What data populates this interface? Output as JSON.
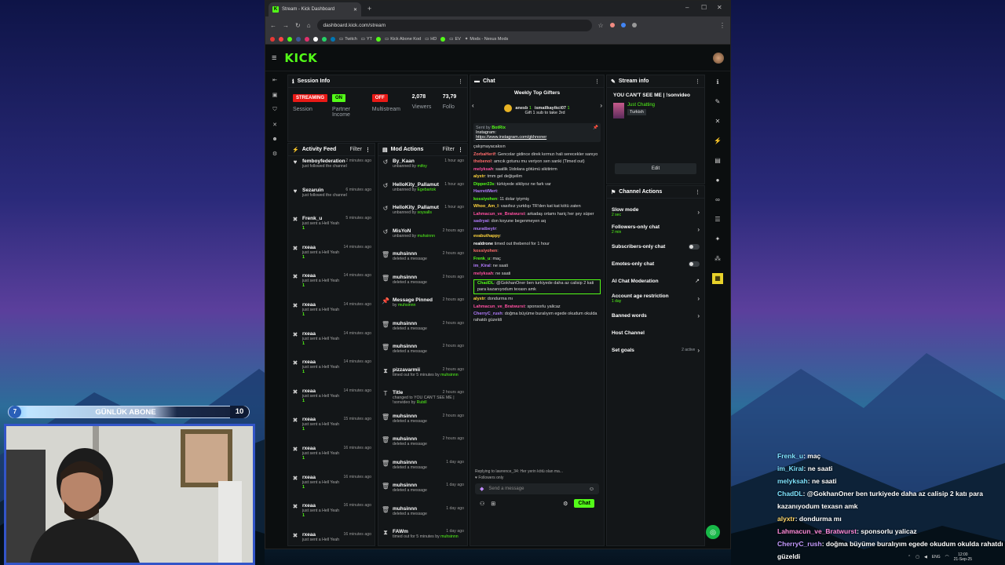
{
  "browser": {
    "tab_title": "Stream - Kick Dashboard",
    "url": "dashboard.kick.com/stream",
    "bookmarks": [
      "Twitch",
      "YT",
      "Kick Abone Kod",
      "HD",
      "EV",
      "Mods - Nexus Mods"
    ]
  },
  "kick": {
    "logo": "KICK"
  },
  "session": {
    "title": "Session Info",
    "stats": [
      {
        "badge": "STREAMING",
        "label": "Session",
        "color": "#e91916"
      },
      {
        "badge": "ON",
        "label": "Partner Income",
        "color": "#53fc18"
      },
      {
        "badge": "OFF",
        "label": "Multistream",
        "color": "#e91916"
      },
      {
        "value": "2,078",
        "label": "Viewers"
      },
      {
        "value": "73,79",
        "label": "Follo"
      }
    ]
  },
  "activity": {
    "title": "Activity Feed",
    "filter": "Filter",
    "items": [
      {
        "icon": "heart-icon",
        "user": "femboyfederation",
        "action": "just followed the channel",
        "time": "2 minutes ago"
      },
      {
        "icon": "heart-icon",
        "user": "Sezaruin",
        "action": "just followed the channel",
        "time": "6 minutes ago"
      },
      {
        "icon": "kick-icon",
        "user": "Frenk_u",
        "action": "just sent a Hell Yeah",
        "count": "1",
        "time": "5 minutes ago"
      },
      {
        "icon": "kick-icon",
        "user": "rxeaa",
        "action": "just sent a Hell Yeah",
        "count": "1",
        "time": "14 minutes ago"
      },
      {
        "icon": "kick-icon",
        "user": "rxeaa",
        "action": "just sent a Hell Yeah",
        "count": "1",
        "time": "14 minutes ago"
      },
      {
        "icon": "kick-icon",
        "user": "rxeaa",
        "action": "just sent a Hell Yeah",
        "count": "1",
        "time": "14 minutes ago"
      },
      {
        "icon": "kick-icon",
        "user": "rxeaa",
        "action": "just sent a Hell Yeah",
        "count": "1",
        "time": "14 minutes ago"
      },
      {
        "icon": "kick-icon",
        "user": "rxeaa",
        "action": "just sent a Hell Yeah",
        "count": "1",
        "time": "14 minutes ago"
      },
      {
        "icon": "kick-icon",
        "user": "rxeaa",
        "action": "just sent a Hell Yeah",
        "count": "1",
        "time": "14 minutes ago"
      },
      {
        "icon": "kick-icon",
        "user": "rxeaa",
        "action": "just sent a Hell Yeah",
        "count": "1",
        "time": "15 minutes ago"
      },
      {
        "icon": "kick-icon",
        "user": "rxeaa",
        "action": "just sent a Hell Yeah",
        "count": "1",
        "time": "16 minutes ago"
      },
      {
        "icon": "kick-icon",
        "user": "rxeaa",
        "action": "just sent a Hell Yeah",
        "count": "1",
        "time": "16 minutes ago"
      },
      {
        "icon": "kick-icon",
        "user": "rxeaa",
        "action": "just sent a Hell Yeah",
        "count": "1",
        "time": "16 minutes ago"
      },
      {
        "icon": "kick-icon",
        "user": "rxeaa",
        "action": "just sent a Hell Yeah",
        "time": "16 minutes ago"
      }
    ]
  },
  "mod": {
    "title": "Mod Actions",
    "filter": "Filter",
    "items": [
      {
        "icon": "undo-icon",
        "user": "By_Kaan",
        "line1": "unbanned by",
        "by": "mifoy",
        "time": "1 hour ago"
      },
      {
        "icon": "undo-icon",
        "user": "HelloKity_Pallamut",
        "line1": "unbanned by",
        "by": "Egebartok",
        "time": "1 hour ago"
      },
      {
        "icon": "undo-icon",
        "user": "HelloKity_Pallamut",
        "line1": "unbanned by",
        "by": "soysalls",
        "time": "1 hour ago"
      },
      {
        "icon": "undo-icon",
        "user": "MisYoN",
        "line1": "unbanned by",
        "by": "muhsinnn",
        "time": "2 hours ago"
      },
      {
        "icon": "trash-icon",
        "user": "muhsinnn",
        "line1": "deleted a message",
        "time": "2 hours ago"
      },
      {
        "icon": "trash-icon",
        "user": "muhsinnn",
        "line1": "deleted a message",
        "time": "2 hours ago"
      },
      {
        "icon": "pin-icon",
        "user": "Message Pinned",
        "line1": "by",
        "by": "muhsinnn",
        "time": "2 hours ago"
      },
      {
        "icon": "trash-icon",
        "user": "muhsinnn",
        "line1": "deleted a message",
        "time": "2 hours ago"
      },
      {
        "icon": "trash-icon",
        "user": "muhsinnn",
        "line1": "deleted a message",
        "time": "2 hours ago"
      },
      {
        "icon": "hourglass-icon",
        "user": "pizzavarmii",
        "line1": "timed out for 5 minutes by",
        "by": "muhsinnn",
        "time": "2 hours ago"
      },
      {
        "icon": "title-icon",
        "user": "Title",
        "line1": "changed to YOU CAN'T SEE ME | !sonvideo by",
        "by": "Rubill",
        "time": "2 hours ago"
      },
      {
        "icon": "trash-icon",
        "user": "muhsinnn",
        "line1": "deleted a message",
        "time": "2 hours ago"
      },
      {
        "icon": "trash-icon",
        "user": "muhsinnn",
        "line1": "deleted a message",
        "time": "2 hours ago"
      },
      {
        "icon": "trash-icon",
        "user": "muhsinnn",
        "line1": "deleted a message",
        "time": "1 day ago"
      },
      {
        "icon": "trash-icon",
        "user": "muhsinnn",
        "line1": "deleted a message",
        "time": "1 day ago"
      },
      {
        "icon": "trash-icon",
        "user": "muhsinnn",
        "line1": "deleted a message",
        "time": "1 day ago"
      },
      {
        "icon": "hourglass-icon",
        "user": "FAWm",
        "line1": "timed out for 5 minutes by",
        "by": "muhsinnn",
        "time": "1 day ago"
      }
    ]
  },
  "chat": {
    "title": "Chat",
    "gifters_title": "Weekly Top Gifters",
    "gifters": [
      {
        "name": "anesb",
        "count": "1"
      },
      {
        "name": "ismailkayikci07",
        "count": "1"
      }
    ],
    "gift_cta": "Gift 1 sub to take 3rd",
    "pinned": {
      "sent_by": "Sent by",
      "bot": "BotRix",
      "text": "Instagram:",
      "link": "https://www.instagram.com/gkhnoner"
    },
    "messages": [
      {
        "user": "",
        "text": "çalışmayacaksın",
        "color": "#ddd"
      },
      {
        "user": "ZorbaHerif",
        "text": ": Gencolar gidince direk kırmızı hali serecekler sanıyo",
        "color": "#ff6b6b"
      },
      {
        "user": "thebenol",
        "text": ": amcık gotunu mu veriyon sen sanki (Timed out)",
        "color": "#ff6b6b"
      },
      {
        "user": "melyksah",
        "text": ": saatlik 1tdolara götümü sikitirirm",
        "color": "#ff4fa0"
      },
      {
        "user": "alyxtr",
        "text": ": tmm gel değişelim",
        "color": "#ffd53d"
      },
      {
        "user": "Dipper23s",
        "text": ": türkiyede sikliyoz ne fark var",
        "color": "#53fc18"
      },
      {
        "user": "HazretiMert",
        "text": ":",
        "color": "#b47cff"
      },
      {
        "user": "kossiyohen",
        "text": ": 11 dolar iyiymiş",
        "color": "#53fc18"
      },
      {
        "user": "Whoo_Am_I",
        "text": ": vasıfsız yurtdışı TR'den kat kat kötü zaten",
        "color": "#ffd53d"
      },
      {
        "user": "Lahmacun_ve_Bratwurst",
        "text": ": arkadaş ortamı hariç her şey süper",
        "color": "#ff4fa0"
      },
      {
        "user": "sadryat",
        "text": ": don koyune begenmeyen aq",
        "color": "#b47cff"
      },
      {
        "user": "muratbeytr",
        "text": ":",
        "color": "#b47cff"
      },
      {
        "user": "evabuthappy",
        "text": ":",
        "color": "#ffd53d"
      },
      {
        "user": "realdrone",
        "text": " timed out thebenol for 1 hour",
        "color": "#fff"
      },
      {
        "user": "kossiyohen",
        "text": ":",
        "color": "#ff6b6b"
      },
      {
        "user": "Frenk_u",
        "text": ": maç",
        "color": "#53fc18"
      },
      {
        "user": "im_Kiral",
        "text": ": ne saati",
        "color": "#b47cff"
      },
      {
        "user": "melyksah",
        "text": ": ne saati",
        "color": "#ff4fa0"
      },
      {
        "user": "ChadDL",
        "text": ": @GokhanOner ben turkiyede daha az calisip 2 kati para kazanıyodum texasn amk",
        "color": "#53fc18"
      },
      {
        "user": "alyxtr",
        "text": ": dondurma mı",
        "color": "#ffd53d"
      },
      {
        "user": "Lahmacun_ve_Bratwurst",
        "text": ": sponsorlu yalicaz",
        "color": "#ff4fa0"
      },
      {
        "user": "CherryC_rush",
        "text": ": doğma büyüme buralıyım egede okudum okulda rahatdı güzeldi",
        "color": "#b47cff"
      }
    ],
    "replying": "Replying to lawrence_34: Her yerin kötü olan ma...",
    "followers_only": "Followers only",
    "send_placeholder": "Send a message",
    "send_button": "Chat"
  },
  "stream_info": {
    "title": "Stream info",
    "stream_title": "YOU CAN'T SEE ME | !sonvideo",
    "category": "Just Chatting",
    "tag": "Turkish",
    "edit": "Edit"
  },
  "channel_actions": {
    "title": "Channel Actions",
    "items": [
      {
        "label": "Slow mode",
        "sub": "2 sec",
        "control": "chevron"
      },
      {
        "label": "Followers-only chat",
        "sub": "2 min",
        "control": "chevron"
      },
      {
        "label": "Subscribers-only chat",
        "control": "toggle"
      },
      {
        "label": "Emotes-only chat",
        "control": "toggle"
      },
      {
        "label": "AI Chat Moderation",
        "control": "ext"
      },
      {
        "label": "Account age restriction",
        "sub": "1 day",
        "control": "chevron"
      },
      {
        "label": "Banned words",
        "control": "chevron"
      },
      {
        "label": "Host Channel",
        "control": "none"
      },
      {
        "label": "Set goals",
        "extra": "2 active",
        "control": "chevron"
      }
    ]
  },
  "overlay": {
    "abone_left": "7",
    "abone_title": "GÜNLÜK ABONE",
    "abone_right": "10",
    "abone_progress": 0.7,
    "chat": [
      {
        "user": "Frenk_u",
        "text": ": maç",
        "color": "#7fe3ff"
      },
      {
        "user": "im_Kiral",
        "text": ": ne saati",
        "color": "#7fe3ff"
      },
      {
        "user": "melyksah",
        "text": ": ne saati",
        "color": "#7fe3ff"
      },
      {
        "user": "ChadDL",
        "text": ": @GokhanOner ben turkiyede daha az calisip 2 katı para kazanıyodum texasn amk",
        "color": "#7fe3ff"
      },
      {
        "user": "alyxtr",
        "text": ": dondurma mı",
        "color": "#ffd76a"
      },
      {
        "user": "Lahmacun_ve_Bratwurst",
        "text": ": sponsorlu yalicaz",
        "color": "#ff8ad8"
      },
      {
        "user": "CherryC_rush",
        "text": ": doğma büyüme buralıyım egede okudum okulda rahatdı güzeldi",
        "color": "#c49bff"
      }
    ]
  },
  "taskbar": {
    "lang": "ENG",
    "time": "12:00",
    "date": "21-Sep-25"
  }
}
